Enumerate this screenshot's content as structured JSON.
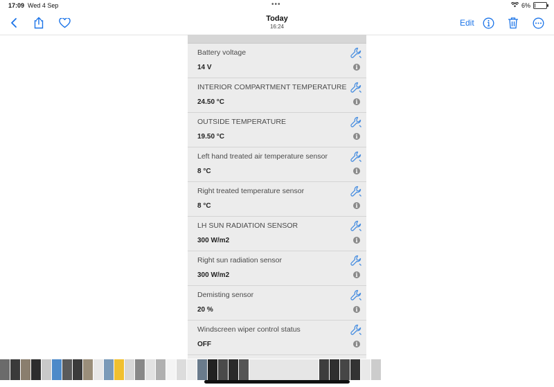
{
  "status_bar": {
    "time": "17:09",
    "date": "Wed 4 Sep",
    "battery_pct": "6%",
    "battery_level": 0.06
  },
  "nav": {
    "title": "Today",
    "subtitle": "16:24",
    "edit_label": "Edit"
  },
  "readings": [
    {
      "label": "Battery voltage",
      "value": "14 V"
    },
    {
      "label": "INTERIOR COMPARTMENT TEMPERATURE",
      "value": "24.50 °C"
    },
    {
      "label": "OUTSIDE TEMPERATURE",
      "value": "19.50 °C"
    },
    {
      "label": "Left hand treated air temperature sensor",
      "value": "8 °C"
    },
    {
      "label": "Right treated temperature sensor",
      "value": "8 °C"
    },
    {
      "label": "LH SUN RADIATION SENSOR",
      "value": "300 W/m2"
    },
    {
      "label": "Right sun radiation sensor",
      "value": "300 W/m2"
    },
    {
      "label": "Demisting sensor",
      "value": "20 %"
    },
    {
      "label": "Windscreen wiper control status",
      "value": "OFF"
    }
  ],
  "colors": {
    "accent": "#1a73e8",
    "wrench": "#4a8fe0",
    "panel": "#ececec"
  },
  "thumbnails": [
    "#6b6b6b",
    "#3a3a3a",
    "#8a7e6e",
    "#2d2d2d",
    "#c9c9c9",
    "#4d8ac9",
    "#5a5a5a",
    "#3b3b3b",
    "#9a8e7a",
    "#e8e8e8",
    "#7a9ab8",
    "#f0c030",
    "#d8d8d8",
    "#888888",
    "#e2e2e2",
    "#b0b0b0",
    "#f4f4f4",
    "#dcdcdc",
    "#eeeeee",
    "#6a7b8c",
    "#222222",
    "#4a4a4a",
    "#2a2a2a",
    "#555555",
    "#e6e6e6",
    "#3d3d3d",
    "#2f2f2f",
    "#464646",
    "#333333",
    "#e9e9e9",
    "#cccccc"
  ]
}
